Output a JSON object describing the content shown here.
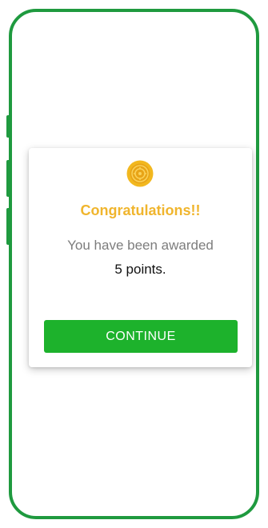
{
  "dialog": {
    "icon": "coin-icon",
    "title": "Congratulations!!",
    "message": "You have been awarded",
    "points_text": "5 points.",
    "continue_label": "CONTINUE"
  },
  "colors": {
    "frame": "#1f9a3f",
    "title": "#f0b52d",
    "message": "#7d7d7d",
    "button": "#1db22c",
    "coin": "#f2b81f"
  }
}
